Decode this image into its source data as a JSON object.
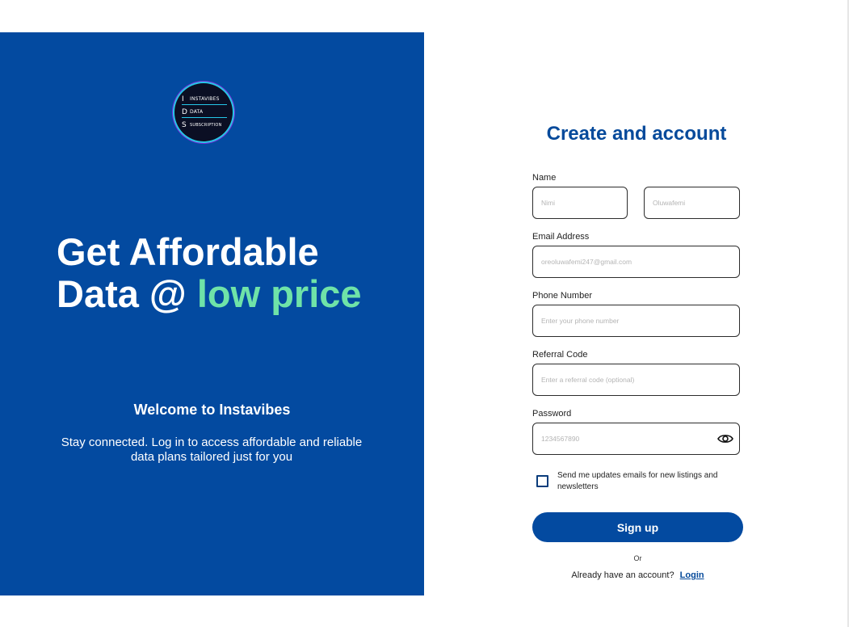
{
  "hero": {
    "logo": {
      "lines": [
        {
          "letter": "I",
          "word": "INSTAVIBES"
        },
        {
          "letter": "D",
          "word": "DATA"
        },
        {
          "letter": "S",
          "word": "SUBSCRIPTION"
        }
      ]
    },
    "headline": {
      "line1": "Get Affordable",
      "line2_prefix": "Data @",
      "line2_accent": "low price"
    },
    "welcome": "Welcome to Instavibes",
    "subtitle": "Stay connected. Log in to access affordable and reliable data plans tailored just for you"
  },
  "form": {
    "title": "Create and account",
    "name": {
      "label": "Name",
      "first_placeholder": "Nimi",
      "last_placeholder": "Oluwafemi"
    },
    "email": {
      "label": "Email Address",
      "placeholder": "oreoluwafemi247@gmail.com"
    },
    "phone": {
      "label": "Phone Number",
      "placeholder": "Enter your phone number"
    },
    "referral": {
      "label": "Referral Code",
      "placeholder": "Enter a referral code (optional)"
    },
    "password": {
      "label": "Password",
      "placeholder": "1234567890",
      "toggle_icon": "eye-icon"
    },
    "updates_checkbox": {
      "checked": false,
      "label": "Send me updates emails for new listings and newsletters"
    },
    "signup_label": "Sign up",
    "or_text": "Or",
    "login_prompt": "Already have an account?",
    "login_link": "Login"
  },
  "colors": {
    "brand_blue": "#034aa0",
    "title_blue": "#064a9b",
    "accent_green": "#6fe3a8"
  }
}
